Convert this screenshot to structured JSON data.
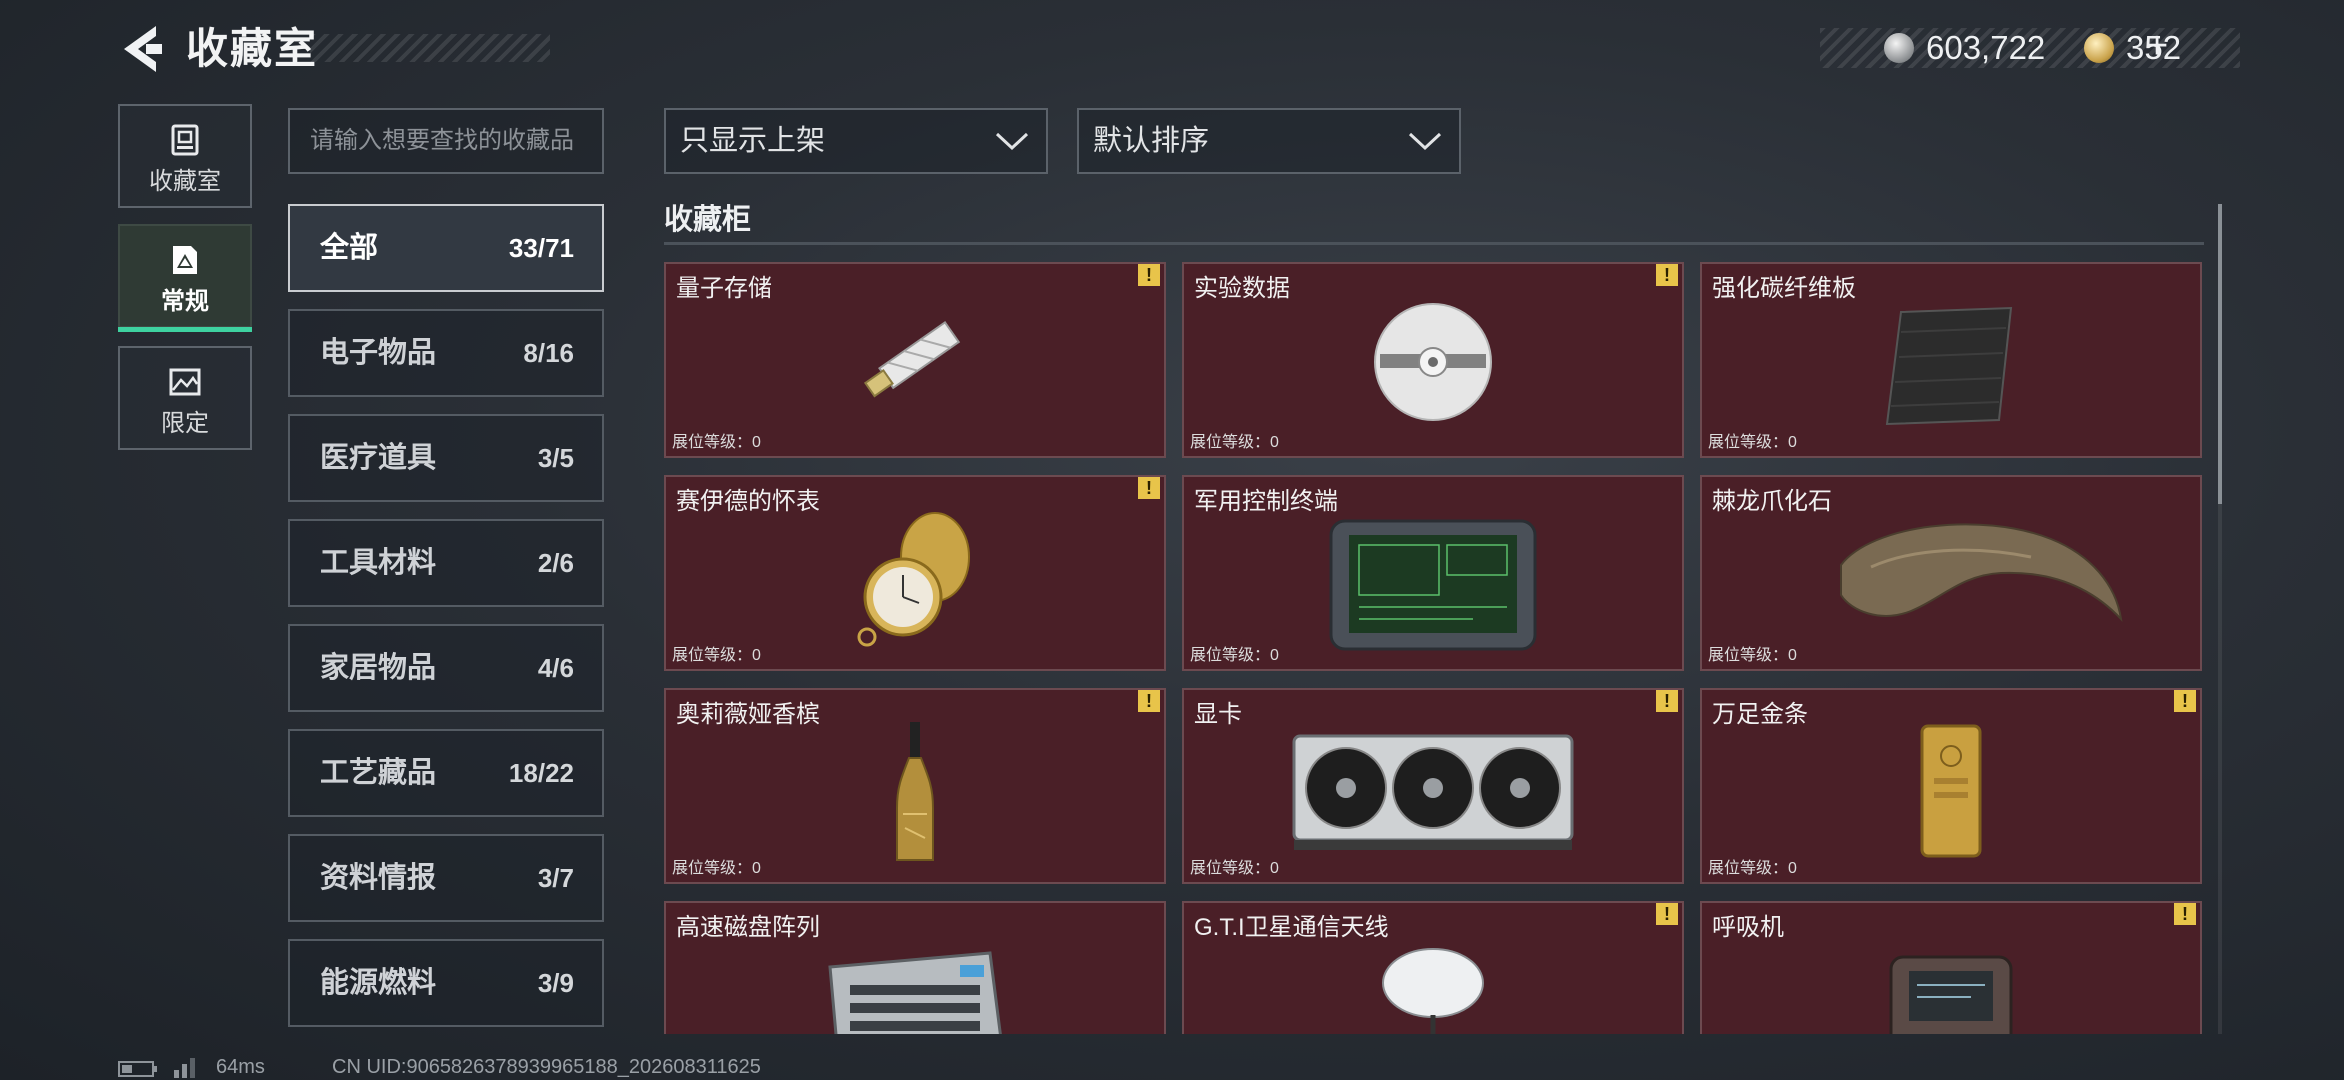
{
  "header": {
    "title": "收藏室",
    "currency_1": "603,722",
    "currency_2": "352",
    "plus_symbol": "+"
  },
  "side_tabs": [
    {
      "label": "收藏室",
      "icon": "trophy-icon"
    },
    {
      "label": "常规",
      "icon": "doc-icon",
      "active": true
    },
    {
      "label": "限定",
      "icon": "picture-icon"
    }
  ],
  "search": {
    "placeholder": "请输入想要查找的收藏品"
  },
  "categories": [
    {
      "name": "全部",
      "count": "33/71",
      "active": true
    },
    {
      "name": "电子物品",
      "count": "8/16"
    },
    {
      "name": "医疗道具",
      "count": "3/5"
    },
    {
      "name": "工具材料",
      "count": "2/6"
    },
    {
      "name": "家居物品",
      "count": "4/6"
    },
    {
      "name": "工艺藏品",
      "count": "18/22"
    },
    {
      "name": "资料情报",
      "count": "3/7"
    },
    {
      "name": "能源燃料",
      "count": "3/9"
    }
  ],
  "filters": {
    "filter_label": "只显示上架",
    "sort_label": "默认排序"
  },
  "section": {
    "title": "收藏柜"
  },
  "items": [
    {
      "name": "量子存储",
      "level": "展位等级：0",
      "warn": true,
      "icon": "usb-drive-icon"
    },
    {
      "name": "实验数据",
      "level": "展位等级：0",
      "warn": true,
      "icon": "disc-icon"
    },
    {
      "name": "强化碳纤维板",
      "level": "展位等级：0",
      "warn": false,
      "icon": "carbon-plate-icon"
    },
    {
      "name": "赛伊德的怀表",
      "level": "展位等级：0",
      "warn": true,
      "icon": "pocket-watch-icon"
    },
    {
      "name": "军用控制终端",
      "level": "展位等级：0",
      "warn": false,
      "icon": "terminal-icon"
    },
    {
      "name": "棘龙爪化石",
      "level": "展位等级：0",
      "warn": false,
      "icon": "claw-fossil-icon"
    },
    {
      "name": "奥莉薇娅香槟",
      "level": "展位等级：0",
      "warn": true,
      "icon": "champagne-icon"
    },
    {
      "name": "显卡",
      "level": "展位等级：0",
      "warn": true,
      "icon": "gpu-icon"
    },
    {
      "name": "万足金条",
      "level": "展位等级：0",
      "warn": true,
      "icon": "gold-bar-icon"
    },
    {
      "name": "高速磁盘阵列",
      "level": "",
      "warn": false,
      "icon": "disk-array-icon"
    },
    {
      "name": "G.T.I卫星通信天线",
      "level": "",
      "warn": true,
      "icon": "satellite-dish-icon"
    },
    {
      "name": "呼吸机",
      "level": "",
      "warn": true,
      "icon": "ventilator-icon"
    }
  ],
  "footer": {
    "ping": "64ms",
    "uid": "CN UID:9065826378939965188_202608311625"
  },
  "colors": {
    "card_bg": "#4a1f27",
    "accent_tab": "#3ed2a0",
    "warn": "#e8c44a"
  }
}
